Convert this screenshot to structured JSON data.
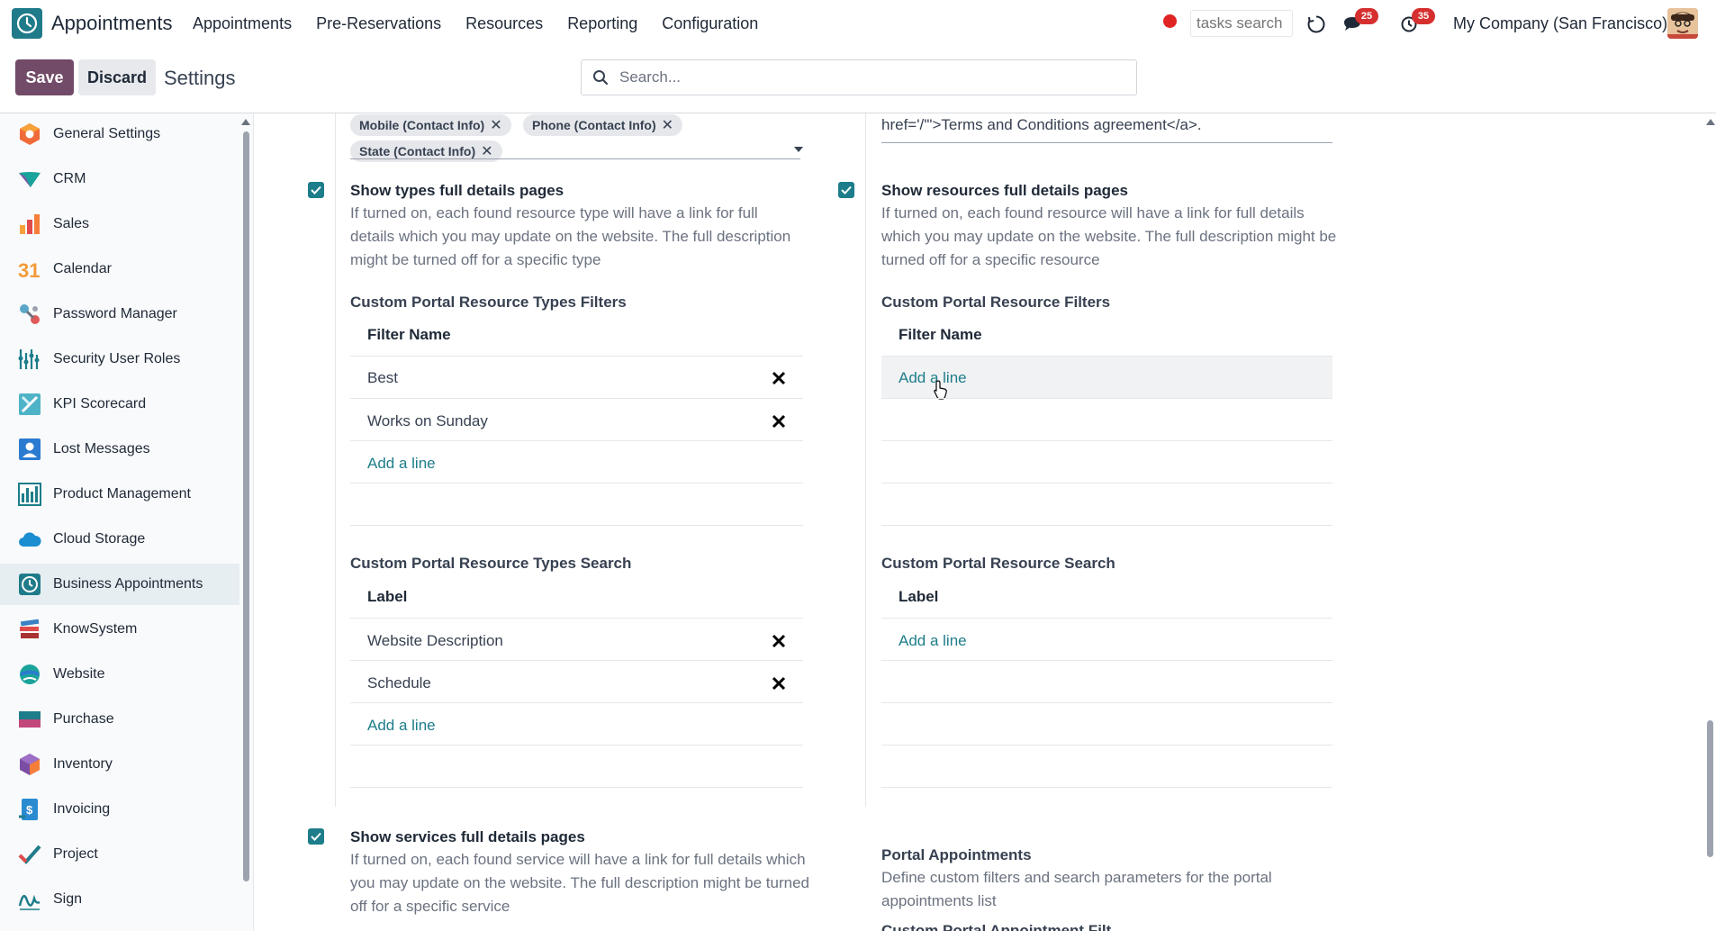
{
  "app": {
    "name": "Appointments",
    "menu": [
      "Appointments",
      "Pre-Reservations",
      "Resources",
      "Reporting",
      "Configuration"
    ],
    "tasks_search_placeholder": "tasks search",
    "messages_badge": "25",
    "activities_badge": "35",
    "company": "My Company (San Francisco)"
  },
  "control": {
    "save_label": "Save",
    "discard_label": "Discard",
    "breadcrumb": "Settings",
    "search_placeholder": "Search..."
  },
  "sidebar": {
    "items": [
      {
        "label": "General Settings",
        "icon": "general-settings-icon"
      },
      {
        "label": "CRM",
        "icon": "crm-icon"
      },
      {
        "label": "Sales",
        "icon": "sales-icon"
      },
      {
        "label": "Calendar",
        "icon": "calendar-icon"
      },
      {
        "label": "Password Manager",
        "icon": "password-manager-icon"
      },
      {
        "label": "Security User Roles",
        "icon": "security-roles-icon"
      },
      {
        "label": "KPI Scorecard",
        "icon": "kpi-icon"
      },
      {
        "label": "Lost Messages",
        "icon": "lost-messages-icon"
      },
      {
        "label": "Product Management",
        "icon": "product-management-icon"
      },
      {
        "label": "Cloud Storage",
        "icon": "cloud-storage-icon"
      },
      {
        "label": "Business Appointments",
        "icon": "business-appointments-icon",
        "active": true
      },
      {
        "label": "KnowSystem",
        "icon": "knowsystem-icon"
      },
      {
        "label": "Website",
        "icon": "website-icon"
      },
      {
        "label": "Purchase",
        "icon": "purchase-icon"
      },
      {
        "label": "Inventory",
        "icon": "inventory-icon"
      },
      {
        "label": "Invoicing",
        "icon": "invoicing-icon"
      },
      {
        "label": "Project",
        "icon": "project-icon"
      },
      {
        "label": "Sign",
        "icon": "sign-icon"
      }
    ]
  },
  "left": {
    "tags": [
      "Mobile (Contact Info)",
      "Phone (Contact Info)",
      "State (Contact Info)"
    ],
    "types_setting": {
      "checked": true,
      "title": "Show types full details pages",
      "desc": "If turned on, each found resource type will have a link for full details which you may update on the website. The full description might be turned off for a specific type"
    },
    "type_filters": {
      "title": "Custom Portal Resource Types Filters",
      "header": "Filter Name",
      "rows": [
        "Best",
        "Works on Sunday"
      ],
      "add": "Add a line"
    },
    "type_search": {
      "title": "Custom Portal Resource Types Search",
      "header": "Label",
      "rows": [
        "Website Description",
        "Schedule"
      ],
      "add": "Add a line"
    },
    "services_setting": {
      "checked": true,
      "title": "Show services full details pages",
      "desc": "If turned on, each found service will have a link for full details which you may update on the website. The full description might be turned off for a specific service"
    }
  },
  "right": {
    "href_text": "href='/'\">Terms and Conditions agreement</a>.",
    "resources_setting": {
      "checked": true,
      "title": "Show resources full details pages",
      "desc": "If turned on, each found resource will have a link for full details which you may update on the website. The full description might be turned off for a specific resource"
    },
    "res_filters": {
      "title": "Custom Portal Resource Filters",
      "header": "Filter Name",
      "add": "Add a line"
    },
    "res_search": {
      "title": "Custom Portal Resource Search",
      "header": "Label",
      "add": "Add a line"
    },
    "portal_appointments": {
      "title": "Portal Appointments",
      "desc": "Define custom filters and search parameters for the portal appointments list",
      "cut_title": "Custom Portal Appointment Filt"
    }
  },
  "colors": {
    "primary": "#714b67",
    "accent": "#1d7d8a",
    "badge": "#d62f2f"
  }
}
